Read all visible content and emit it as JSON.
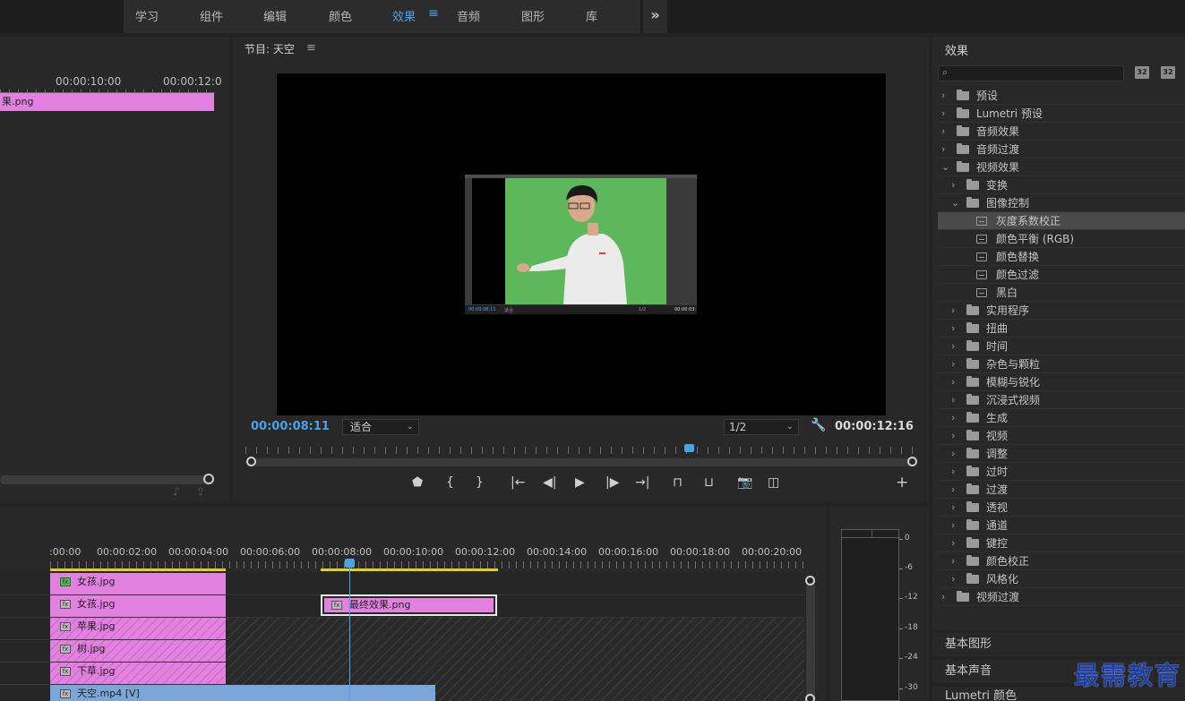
{
  "workspace": {
    "tabs": [
      "学习",
      "组件",
      "编辑",
      "颜色",
      "效果",
      "音频",
      "图形",
      "库"
    ],
    "active": "效果",
    "more_icon": "chevron-double-right-icon"
  },
  "source": {
    "timecodes": [
      "00:00:10:00",
      "00:00:12:0"
    ],
    "clip_label": "果.png"
  },
  "program": {
    "title": "节目: 天空",
    "menu_icon": "hamburger-icon",
    "current_tc": "00:00:08:11",
    "fit_label": "适合",
    "resolution": "1/2",
    "duration": "00:00:12:16",
    "nested": {
      "tc": "00:00:08:11",
      "fit": "适合",
      "res": "1/2",
      "dur": "00:00:03:"
    }
  },
  "effects": {
    "title": "效果",
    "search_placeholder": "",
    "icon_a": "32",
    "icon_b": "32",
    "tree": [
      {
        "label": "预设",
        "level": 0,
        "kind": "preset",
        "state": "closed"
      },
      {
        "label": "Lumetri 预设",
        "level": 0,
        "kind": "preset",
        "state": "closed"
      },
      {
        "label": "音频效果",
        "level": 0,
        "kind": "folder",
        "state": "closed"
      },
      {
        "label": "音频过渡",
        "level": 0,
        "kind": "folder",
        "state": "closed"
      },
      {
        "label": "视频效果",
        "level": 0,
        "kind": "folder",
        "state": "open"
      },
      {
        "label": "变换",
        "level": 1,
        "kind": "folder",
        "state": "closed"
      },
      {
        "label": "图像控制",
        "level": 1,
        "kind": "folder",
        "state": "open"
      },
      {
        "label": "灰度系数校正",
        "level": 2,
        "kind": "effect",
        "selected": true
      },
      {
        "label": "颜色平衡 (RGB)",
        "level": 2,
        "kind": "effect"
      },
      {
        "label": "颜色替换",
        "level": 2,
        "kind": "effect"
      },
      {
        "label": "颜色过滤",
        "level": 2,
        "kind": "effect"
      },
      {
        "label": "黑白",
        "level": 2,
        "kind": "effect"
      },
      {
        "label": "实用程序",
        "level": 1,
        "kind": "folder",
        "state": "closed"
      },
      {
        "label": "扭曲",
        "level": 1,
        "kind": "folder",
        "state": "closed"
      },
      {
        "label": "时间",
        "level": 1,
        "kind": "folder",
        "state": "closed"
      },
      {
        "label": "杂色与颗粒",
        "level": 1,
        "kind": "folder",
        "state": "closed"
      },
      {
        "label": "模糊与锐化",
        "level": 1,
        "kind": "folder",
        "state": "closed"
      },
      {
        "label": "沉浸式视频",
        "level": 1,
        "kind": "folder",
        "state": "closed"
      },
      {
        "label": "生成",
        "level": 1,
        "kind": "folder",
        "state": "closed"
      },
      {
        "label": "视频",
        "level": 1,
        "kind": "folder",
        "state": "closed"
      },
      {
        "label": "调整",
        "level": 1,
        "kind": "folder",
        "state": "closed"
      },
      {
        "label": "过时",
        "level": 1,
        "kind": "folder",
        "state": "closed"
      },
      {
        "label": "过渡",
        "level": 1,
        "kind": "folder",
        "state": "closed"
      },
      {
        "label": "透视",
        "level": 1,
        "kind": "folder",
        "state": "closed"
      },
      {
        "label": "通道",
        "level": 1,
        "kind": "folder",
        "state": "closed"
      },
      {
        "label": "键控",
        "level": 1,
        "kind": "folder",
        "state": "closed"
      },
      {
        "label": "颜色校正",
        "level": 1,
        "kind": "folder",
        "state": "closed"
      },
      {
        "label": "风格化",
        "level": 1,
        "kind": "folder",
        "state": "closed"
      },
      {
        "label": "视频过渡",
        "level": 0,
        "kind": "folder",
        "state": "closed"
      }
    ],
    "bottom_tabs": [
      "基本图形",
      "基本声音",
      "Lumetri 颜色"
    ]
  },
  "timeline": {
    "timecodes": [
      ":00:00",
      "00:00:02:00",
      "00:00:04:00",
      "00:00:06:00",
      "00:00:08:00",
      "00:00:10:00",
      "00:00:12:00",
      "00:00:14:00",
      "00:00:16:00",
      "00:00:18:00",
      "00:00:20:00"
    ],
    "clips": {
      "v6": "女孩.jpg",
      "v5": "女孩.jpg",
      "v5b": "最终效果.png",
      "v4": "苹果.jpg",
      "v3": "树.jpg",
      "v2": "下草.jpg",
      "v1": "天空.mp4 [V]"
    }
  },
  "meters": {
    "labels": [
      "0",
      "-6",
      "-12",
      "-18",
      "-24",
      "-30"
    ]
  },
  "watermark": "最需教育"
}
